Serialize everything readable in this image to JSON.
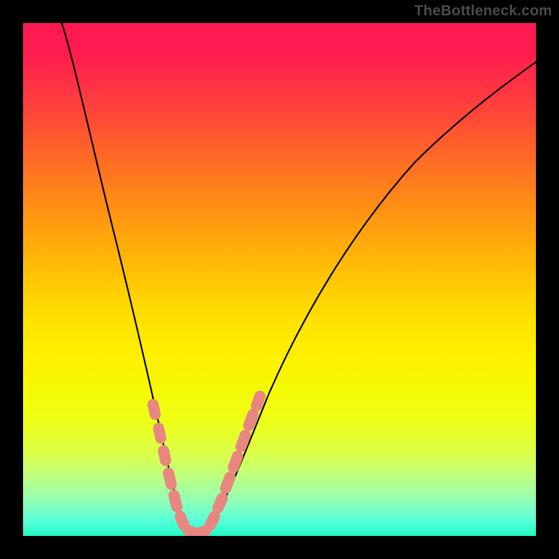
{
  "watermark": "TheBottleneck.com",
  "chart_data": {
    "type": "line",
    "title": "",
    "xlabel": "",
    "ylabel": "",
    "xlim": [
      0,
      100
    ],
    "ylim": [
      0,
      100
    ],
    "background": "red-yellow-green vertical gradient",
    "series": [
      {
        "name": "bottleneck-curve",
        "color": "#000000",
        "x": [
          10,
          12,
          15,
          18,
          20,
          22,
          24,
          26,
          28,
          29,
          30,
          31,
          32,
          34,
          36,
          38,
          40,
          43,
          47,
          52,
          58,
          65,
          73,
          82,
          92,
          100
        ],
        "y": [
          100,
          88,
          72,
          58,
          48,
          40,
          32,
          24,
          16,
          10,
          5,
          2,
          0,
          0,
          2,
          6,
          11,
          18,
          27,
          37,
          47,
          56,
          64,
          71,
          77,
          82
        ]
      },
      {
        "name": "highlight-dots",
        "color": "#e8877f",
        "type": "scatter",
        "x": [
          26.5,
          27.5,
          28.5,
          29.3,
          30.0,
          30.8,
          31.7,
          33.0,
          34.2,
          35.3,
          36.0,
          36.8,
          37.6,
          38.8,
          40.2,
          41.5,
          42.7
        ],
        "y": [
          22,
          18,
          14,
          10,
          6,
          3,
          1,
          0,
          0,
          1,
          3,
          5,
          8,
          12,
          16,
          20,
          24
        ]
      }
    ]
  },
  "colors": {
    "frame": "#000000",
    "curve": "#000000",
    "dots": "#e8877f",
    "watermark": "#4a4a4a"
  }
}
